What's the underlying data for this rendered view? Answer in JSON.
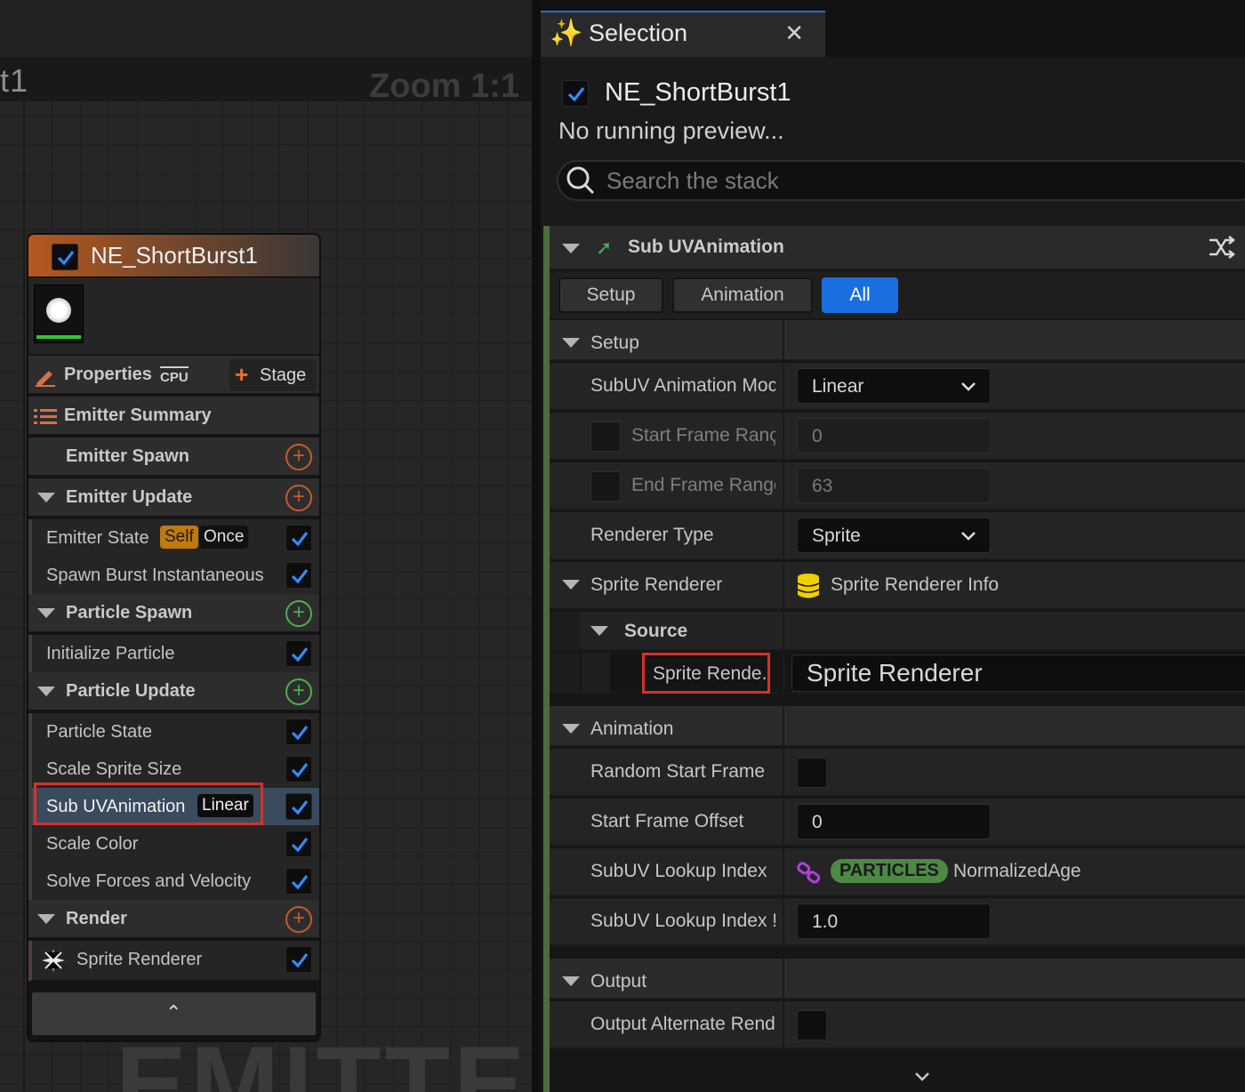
{
  "graph": {
    "title": "t1",
    "zoom": "Zoom 1:1",
    "watermark": "EMITTER"
  },
  "node": {
    "name": "NE_ShortBurst1",
    "properties_label": "Properties",
    "cpu_badge": "CPU",
    "stage_label": "Stage",
    "emitter_summary": "Emitter Summary",
    "emitter_spawn": "Emitter Spawn",
    "emitter_update": "Emitter Update",
    "emitter_state": "Emitter State",
    "self_badge": "Self",
    "once_badge": "Once",
    "spawn_burst": "Spawn Burst Instantaneous",
    "particle_spawn": "Particle Spawn",
    "initialize_particle": "Initialize Particle",
    "particle_update": "Particle Update",
    "particle_state": "Particle State",
    "scale_sprite_size": "Scale Sprite Size",
    "sub_uv": "Sub UVAnimation",
    "linear_badge": "Linear",
    "scale_color": "Scale Color",
    "solve_forces": "Solve Forces and Velocity",
    "render": "Render",
    "sprite_renderer": "Sprite Renderer"
  },
  "panel": {
    "tab_title": "Selection",
    "emitter_name": "NE_ShortBurst1",
    "preview_status": "No running preview...",
    "search_placeholder": "Search the stack",
    "module_title": "Sub UVAnimation",
    "filters": [
      "Setup",
      "Animation",
      "All"
    ],
    "setup_cat": "Setup",
    "subuv_mode_label": "SubUV Animation Moc",
    "subuv_mode_value": "Linear",
    "start_frame_label": "Start Frame Ranç",
    "start_frame_value": "0",
    "end_frame_label": "End Frame Range",
    "end_frame_value": "63",
    "renderer_type_label": "Renderer Type",
    "renderer_type_value": "Sprite",
    "sprite_renderer_cat": "Sprite Renderer",
    "sprite_renderer_info": "Sprite Renderer Info",
    "source_cat": "Source",
    "sprite_rende_label": "Sprite Rende...",
    "sprite_renderer_value": "Sprite Renderer",
    "animation_cat": "Animation",
    "random_start_label": "Random Start Frame",
    "start_offset_label": "Start Frame Offset",
    "start_offset_value": "0",
    "lookup_index_label": "SubUV Lookup Index",
    "particles_badge": "PARTICLES",
    "normalized_age": "NormalizedAge",
    "lookup_index_scale_label": "SubUV Lookup Index !",
    "lookup_index_scale_value": "1.0",
    "output_cat": "Output",
    "output_alt_label": "Output Alternate Rend"
  },
  "colors": {
    "accent_blue": "#1a6fe0",
    "highlight_red": "#d4322a",
    "emitter_orange": "#b6581e",
    "particles_green": "#4c8a44"
  }
}
